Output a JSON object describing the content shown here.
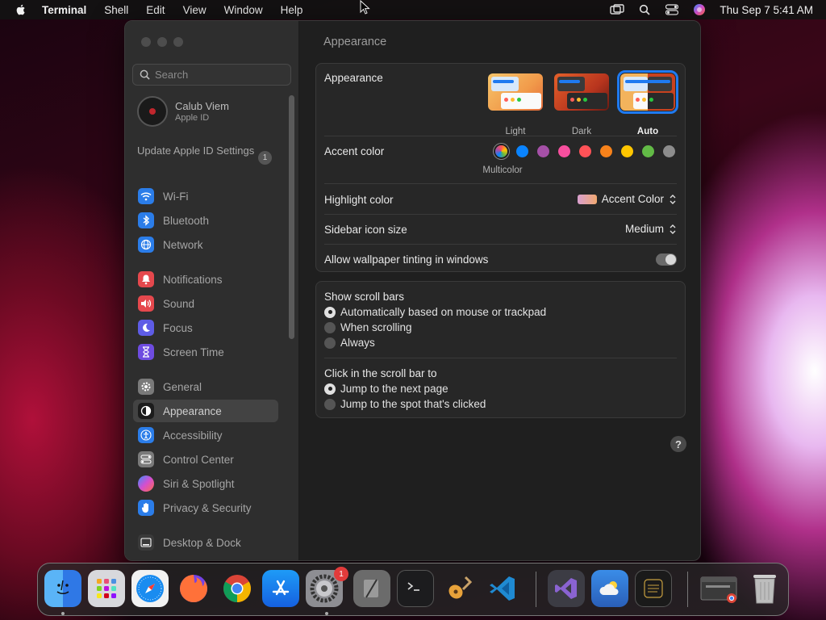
{
  "menubar": {
    "app_name": "Terminal",
    "items": [
      "Shell",
      "Edit",
      "View",
      "Window",
      "Help"
    ],
    "clock": "Thu Sep 7  5:41 AM"
  },
  "sidebar": {
    "search_placeholder": "Search",
    "profile": {
      "name": "Calub Viem",
      "subtitle": "Apple ID"
    },
    "update": {
      "label": "Update Apple ID Settings",
      "badge": "1"
    },
    "items": [
      {
        "label": "Wi-Fi",
        "icon": "wifi-icon",
        "color": "#2b7de9"
      },
      {
        "label": "Bluetooth",
        "icon": "bluetooth-icon",
        "color": "#2b7de9"
      },
      {
        "label": "Network",
        "icon": "globe-icon",
        "color": "#2b7de9"
      },
      {
        "label": "Notifications",
        "icon": "bell-icon",
        "color": "#e5484d"
      },
      {
        "label": "Sound",
        "icon": "speaker-icon",
        "color": "#e5484d"
      },
      {
        "label": "Focus",
        "icon": "moon-icon",
        "color": "#5e5ce6"
      },
      {
        "label": "Screen Time",
        "icon": "hourglass-icon",
        "color": "#6e4ce0"
      },
      {
        "label": "General",
        "icon": "gear-icon",
        "color": "#7a7a7a"
      },
      {
        "label": "Appearance",
        "icon": "appearance-icon",
        "color": "#1c1c1c"
      },
      {
        "label": "Accessibility",
        "icon": "accessibility-icon",
        "color": "#2b7de9"
      },
      {
        "label": "Control Center",
        "icon": "control-center-icon",
        "color": "#7a7a7a"
      },
      {
        "label": "Siri & Spotlight",
        "icon": "siri-icon",
        "color": "#b44fd1"
      },
      {
        "label": "Privacy & Security",
        "icon": "hand-icon",
        "color": "#2b7de9"
      },
      {
        "label": "Desktop & Dock",
        "icon": "dock-icon",
        "color": "#3a3a3a"
      }
    ],
    "active_item": "Appearance"
  },
  "main": {
    "title": "Appearance",
    "appearance": {
      "label": "Appearance",
      "options": [
        "Light",
        "Dark",
        "Auto"
      ],
      "selected": "Auto"
    },
    "accent": {
      "label": "Accent color",
      "selected_label": "Multicolor",
      "colors": [
        "#ffffff",
        "#0a84ff",
        "#a550a7",
        "#f74f9e",
        "#ff5257",
        "#f7821b",
        "#ffc600",
        "#62ba46",
        "#8c8c8c"
      ]
    },
    "highlight": {
      "label": "Highlight color",
      "value": "Accent Color"
    },
    "sidebar_icon_size": {
      "label": "Sidebar icon size",
      "value": "Medium"
    },
    "wallpaper_tinting": {
      "label": "Allow wallpaper tinting in windows",
      "enabled": false
    },
    "scroll_bars": {
      "label": "Show scroll bars",
      "options": [
        "Automatically based on mouse or trackpad",
        "When scrolling",
        "Always"
      ],
      "selected": "Automatically based on mouse or trackpad"
    },
    "click_scroll": {
      "label": "Click in the scroll bar to",
      "options": [
        "Jump to the next page",
        "Jump to the spot that's clicked"
      ],
      "selected": "Jump to the next page"
    },
    "help": "?"
  },
  "dock": {
    "apps": [
      "Finder",
      "Launchpad",
      "Safari",
      "Firefox",
      "Chrome",
      "App Store",
      "System Settings",
      "Script Editor",
      "Terminal",
      "GarageBand",
      "Visual Studio Code",
      "Visual Studio",
      "Weather",
      "Shortcuts",
      "Chrome Window",
      "Trash"
    ],
    "settings_badge": "1"
  }
}
